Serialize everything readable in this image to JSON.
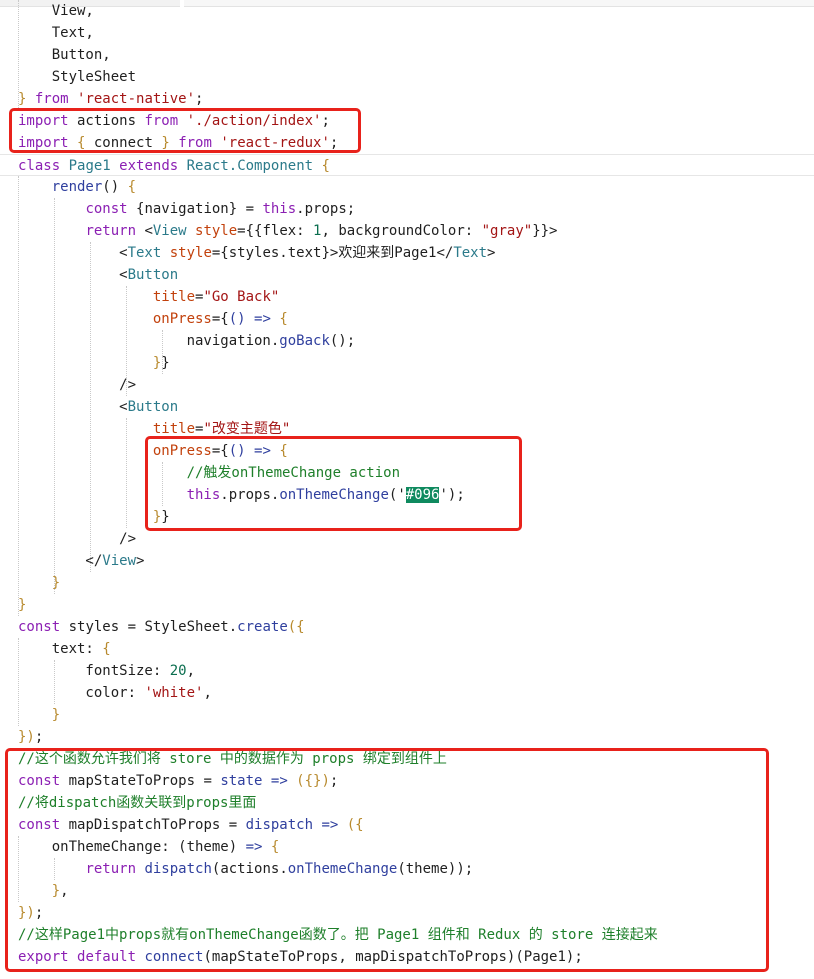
{
  "colors": {
    "keyword": "#8b1fb3",
    "plain": "#1f1f1f",
    "jsx_tag": "#2b7a8a",
    "jsx_attr": "#c2410c",
    "punct": "#b88a2e",
    "string": "#a31515",
    "comment": "#1e7f2a",
    "func": "#2f3f9e",
    "number": "#0b6e4f",
    "prop": "#2f3f9e",
    "selection_bg": "#0f8a5f",
    "annotation": "#e8221b"
  },
  "code": {
    "lines": [
      {
        "tokens": [
          {
            "t": "    View,",
            "c": "plain"
          }
        ]
      },
      {
        "tokens": [
          {
            "t": "    Text,",
            "c": "plain"
          }
        ]
      },
      {
        "tokens": [
          {
            "t": "    Button,",
            "c": "plain"
          }
        ]
      },
      {
        "tokens": [
          {
            "t": "    StyleSheet",
            "c": "plain"
          }
        ]
      },
      {
        "tokens": [
          {
            "t": "} ",
            "c": "punct"
          },
          {
            "t": "from",
            "c": "keyword"
          },
          {
            "t": " ",
            "c": "plain"
          },
          {
            "t": "'react-native'",
            "c": "string"
          },
          {
            "t": ";",
            "c": "plain"
          }
        ]
      },
      {
        "tokens": [
          {
            "t": "import",
            "c": "keyword"
          },
          {
            "t": " actions ",
            "c": "plain"
          },
          {
            "t": "from",
            "c": "keyword"
          },
          {
            "t": " ",
            "c": "plain"
          },
          {
            "t": "'./action/index'",
            "c": "string"
          },
          {
            "t": ";",
            "c": "plain"
          }
        ]
      },
      {
        "tokens": [
          {
            "t": "import",
            "c": "keyword"
          },
          {
            "t": " { ",
            "c": "punct"
          },
          {
            "t": "connect",
            "c": "plain"
          },
          {
            "t": " } ",
            "c": "punct"
          },
          {
            "t": "from",
            "c": "keyword"
          },
          {
            "t": " ",
            "c": "plain"
          },
          {
            "t": "'react-redux'",
            "c": "string"
          },
          {
            "t": ";",
            "c": "plain"
          }
        ]
      },
      {
        "highlight": true,
        "tokens": [
          {
            "t": "class",
            "c": "keyword"
          },
          {
            "t": " Page1 ",
            "c": "jsx_tag"
          },
          {
            "t": "extends",
            "c": "keyword"
          },
          {
            "t": " React.Component ",
            "c": "jsx_tag"
          },
          {
            "t": "{",
            "c": "punct"
          }
        ]
      },
      {
        "tokens": [
          {
            "t": "    ",
            "c": "plain"
          },
          {
            "t": "render",
            "c": "func"
          },
          {
            "t": "() ",
            "c": "plain"
          },
          {
            "t": "{",
            "c": "punct"
          }
        ]
      },
      {
        "tokens": [
          {
            "t": "        ",
            "c": "plain"
          },
          {
            "t": "const",
            "c": "keyword"
          },
          {
            "t": " {navigation} = ",
            "c": "plain"
          },
          {
            "t": "this",
            "c": "keyword"
          },
          {
            "t": ".props;",
            "c": "plain"
          }
        ]
      },
      {
        "tokens": [
          {
            "t": "        ",
            "c": "plain"
          },
          {
            "t": "return",
            "c": "keyword"
          },
          {
            "t": " <",
            "c": "plain"
          },
          {
            "t": "View",
            "c": "jsx_tag"
          },
          {
            "t": " style",
            "c": "jsx_attr"
          },
          {
            "t": "={{flex: ",
            "c": "plain"
          },
          {
            "t": "1",
            "c": "number"
          },
          {
            "t": ", backgroundColor: ",
            "c": "plain"
          },
          {
            "t": "\"gray\"",
            "c": "string"
          },
          {
            "t": "}}>",
            "c": "plain"
          }
        ]
      },
      {
        "tokens": [
          {
            "t": "            <",
            "c": "plain"
          },
          {
            "t": "Text",
            "c": "jsx_tag"
          },
          {
            "t": " style",
            "c": "jsx_attr"
          },
          {
            "t": "={styles.text}>",
            "c": "plain"
          },
          {
            "t": "欢迎来到Page1",
            "c": "plain"
          },
          {
            "t": "</",
            "c": "plain"
          },
          {
            "t": "Text",
            "c": "jsx_tag"
          },
          {
            "t": ">",
            "c": "plain"
          }
        ]
      },
      {
        "tokens": [
          {
            "t": "            <",
            "c": "plain"
          },
          {
            "t": "Button",
            "c": "jsx_tag"
          }
        ]
      },
      {
        "tokens": [
          {
            "t": "                ",
            "c": "plain"
          },
          {
            "t": "title",
            "c": "jsx_attr"
          },
          {
            "t": "=",
            "c": "plain"
          },
          {
            "t": "\"Go Back\"",
            "c": "string"
          }
        ]
      },
      {
        "tokens": [
          {
            "t": "                ",
            "c": "plain"
          },
          {
            "t": "onPress",
            "c": "jsx_attr"
          },
          {
            "t": "={",
            "c": "plain"
          },
          {
            "t": "() =>",
            "c": "prop"
          },
          {
            "t": " {",
            "c": "punct"
          }
        ]
      },
      {
        "tokens": [
          {
            "t": "                    navigation.",
            "c": "plain"
          },
          {
            "t": "goBack",
            "c": "func"
          },
          {
            "t": "();",
            "c": "plain"
          }
        ]
      },
      {
        "tokens": [
          {
            "t": "                ",
            "c": "plain"
          },
          {
            "t": "}",
            "c": "punct"
          },
          {
            "t": "}",
            "c": "plain"
          }
        ]
      },
      {
        "tokens": [
          {
            "t": "            />",
            "c": "plain"
          }
        ]
      },
      {
        "tokens": [
          {
            "t": "            <",
            "c": "plain"
          },
          {
            "t": "Button",
            "c": "jsx_tag"
          }
        ]
      },
      {
        "tokens": [
          {
            "t": "                ",
            "c": "plain"
          },
          {
            "t": "title",
            "c": "jsx_attr"
          },
          {
            "t": "=",
            "c": "plain"
          },
          {
            "t": "\"改变主题色\"",
            "c": "string"
          }
        ]
      },
      {
        "tokens": [
          {
            "t": "                ",
            "c": "plain"
          },
          {
            "t": "onPress",
            "c": "jsx_attr"
          },
          {
            "t": "={",
            "c": "plain"
          },
          {
            "t": "() =>",
            "c": "prop"
          },
          {
            "t": " {",
            "c": "punct"
          }
        ]
      },
      {
        "tokens": [
          {
            "t": "                    ",
            "c": "plain"
          },
          {
            "t": "//触发onThemeChange action",
            "c": "comment"
          }
        ]
      },
      {
        "tokens": [
          {
            "t": "                    ",
            "c": "plain"
          },
          {
            "t": "this",
            "c": "keyword"
          },
          {
            "t": ".props.",
            "c": "plain"
          },
          {
            "t": "onThemeChange",
            "c": "func"
          },
          {
            "t": "('",
            "c": "plain"
          },
          {
            "t": "#096",
            "c": "sel"
          },
          {
            "t": "');",
            "c": "plain"
          }
        ]
      },
      {
        "tokens": [
          {
            "t": "                ",
            "c": "plain"
          },
          {
            "t": "}",
            "c": "punct"
          },
          {
            "t": "}",
            "c": "plain"
          }
        ]
      },
      {
        "tokens": [
          {
            "t": "            />",
            "c": "plain"
          }
        ]
      },
      {
        "tokens": [
          {
            "t": "        </",
            "c": "plain"
          },
          {
            "t": "View",
            "c": "jsx_tag"
          },
          {
            "t": ">",
            "c": "plain"
          }
        ]
      },
      {
        "tokens": [
          {
            "t": "    ",
            "c": "plain"
          },
          {
            "t": "}",
            "c": "punct"
          }
        ]
      },
      {
        "tokens": [
          {
            "t": "}",
            "c": "punct"
          }
        ]
      },
      {
        "tokens": [
          {
            "t": "const",
            "c": "keyword"
          },
          {
            "t": " styles = StyleSheet.",
            "c": "plain"
          },
          {
            "t": "create",
            "c": "func"
          },
          {
            "t": "({",
            "c": "punct"
          }
        ]
      },
      {
        "tokens": [
          {
            "t": "    text: ",
            "c": "plain"
          },
          {
            "t": "{",
            "c": "punct"
          }
        ]
      },
      {
        "tokens": [
          {
            "t": "        fontSize: ",
            "c": "plain"
          },
          {
            "t": "20",
            "c": "number"
          },
          {
            "t": ",",
            "c": "plain"
          }
        ]
      },
      {
        "tokens": [
          {
            "t": "        color: ",
            "c": "plain"
          },
          {
            "t": "'white'",
            "c": "string"
          },
          {
            "t": ",",
            "c": "plain"
          }
        ]
      },
      {
        "tokens": [
          {
            "t": "    ",
            "c": "plain"
          },
          {
            "t": "}",
            "c": "punct"
          }
        ]
      },
      {
        "tokens": [
          {
            "t": "})",
            "c": "punct"
          },
          {
            "t": ";",
            "c": "plain"
          }
        ]
      },
      {
        "tokens": [
          {
            "t": "//这个函数允许我们将 store 中的数据作为 props 绑定到组件上",
            "c": "comment"
          }
        ]
      },
      {
        "tokens": [
          {
            "t": "const",
            "c": "keyword"
          },
          {
            "t": " mapStateToProps = ",
            "c": "plain"
          },
          {
            "t": "state =>",
            "c": "prop"
          },
          {
            "t": " ({})",
            "c": "punct"
          },
          {
            "t": ";",
            "c": "plain"
          }
        ]
      },
      {
        "tokens": [
          {
            "t": "//将dispatch函数关联到props里面",
            "c": "comment"
          }
        ]
      },
      {
        "tokens": [
          {
            "t": "const",
            "c": "keyword"
          },
          {
            "t": " mapDispatchToProps = ",
            "c": "plain"
          },
          {
            "t": "dispatch =>",
            "c": "prop"
          },
          {
            "t": " ({",
            "c": "punct"
          }
        ]
      },
      {
        "tokens": [
          {
            "t": "    onThemeChange: (theme) ",
            "c": "plain"
          },
          {
            "t": "=>",
            "c": "prop"
          },
          {
            "t": " {",
            "c": "punct"
          }
        ]
      },
      {
        "tokens": [
          {
            "t": "        ",
            "c": "plain"
          },
          {
            "t": "return",
            "c": "keyword"
          },
          {
            "t": " ",
            "c": "plain"
          },
          {
            "t": "dispatch",
            "c": "func"
          },
          {
            "t": "(actions.",
            "c": "plain"
          },
          {
            "t": "onThemeChange",
            "c": "func"
          },
          {
            "t": "(theme));",
            "c": "plain"
          }
        ]
      },
      {
        "tokens": [
          {
            "t": "    }",
            "c": "punct"
          },
          {
            "t": ",",
            "c": "plain"
          }
        ]
      },
      {
        "tokens": [
          {
            "t": "})",
            "c": "punct"
          },
          {
            "t": ";",
            "c": "plain"
          }
        ]
      },
      {
        "tokens": [
          {
            "t": "//这样Page1中props就有onThemeChange函数了。把 Page1 组件和 Redux 的 store 连接起来",
            "c": "comment"
          }
        ]
      },
      {
        "tokens": [
          {
            "t": "export",
            "c": "keyword"
          },
          {
            "t": " ",
            "c": "plain"
          },
          {
            "t": "default",
            "c": "keyword"
          },
          {
            "t": " ",
            "c": "plain"
          },
          {
            "t": "connect",
            "c": "func"
          },
          {
            "t": "(mapStateToProps, mapDispatchToProps)(Page1);",
            "c": "plain"
          }
        ]
      }
    ]
  }
}
